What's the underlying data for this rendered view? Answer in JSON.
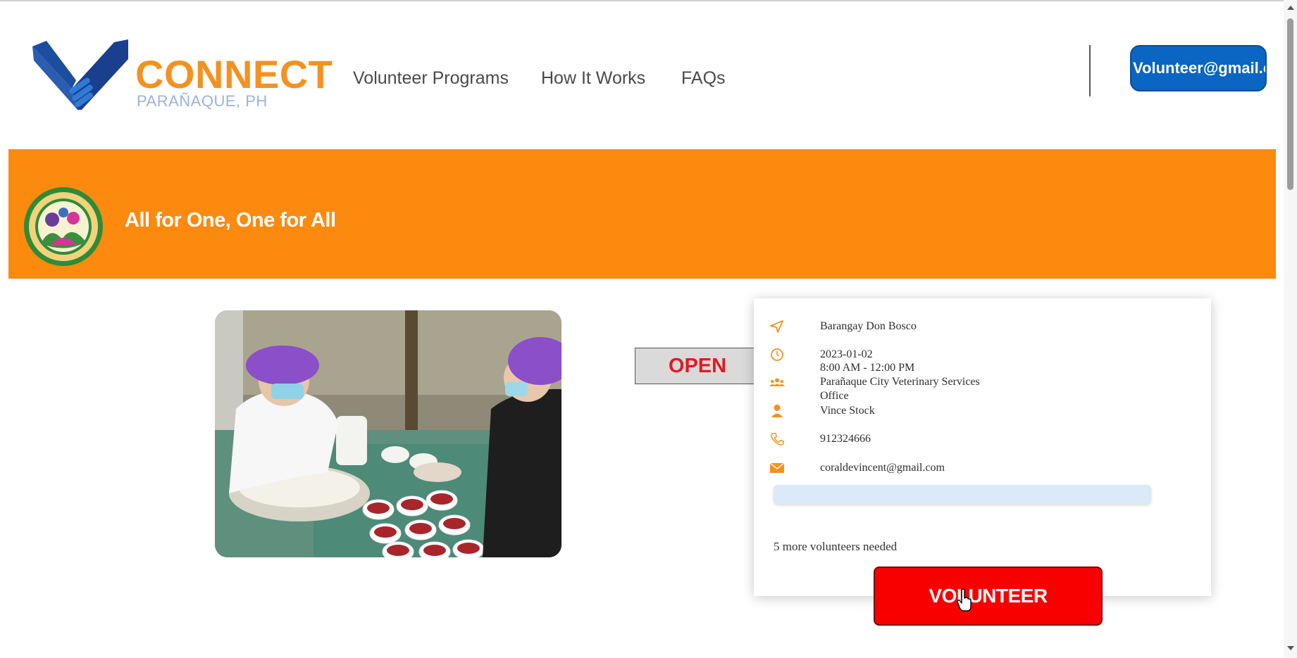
{
  "header": {
    "brand_name": "CONNECT",
    "brand_location": "PARAÑAQUE, PH",
    "nav": [
      {
        "label": "Volunteer Programs"
      },
      {
        "label": "How It Works"
      },
      {
        "label": "FAQs"
      }
    ],
    "account_label": "Volunteer@gmail.com"
  },
  "banner": {
    "title": "All for One, One for All",
    "org_logo_icon": "city-nutrition-office-seal-icon",
    "background_color": "#fc8a0f"
  },
  "event": {
    "status": "OPEN",
    "location": "Barangay Don Bosco",
    "date": "2023-01-02",
    "time": "8:00 AM - 12:00 PM",
    "organization_line1": "Parañaque City Veterinary Services",
    "organization_line2": "Office",
    "contact_person": "Vince Stock",
    "phone": "912324666",
    "email": "coraldevincent@gmail.com",
    "volunteers_needed": "5 more volunteers needed",
    "progress_fraction": 0,
    "button_label": "VOLUNTEER"
  },
  "icons": {
    "location": "location-arrow-icon",
    "time": "clock-icon",
    "organization": "group-icon",
    "contact": "person-icon",
    "phone": "phone-icon",
    "email": "envelope-icon"
  },
  "colors": {
    "accent_orange": "#f39220",
    "primary_blue": "#0a66c2",
    "action_red": "#f80000",
    "status_red": "#e11b22"
  }
}
